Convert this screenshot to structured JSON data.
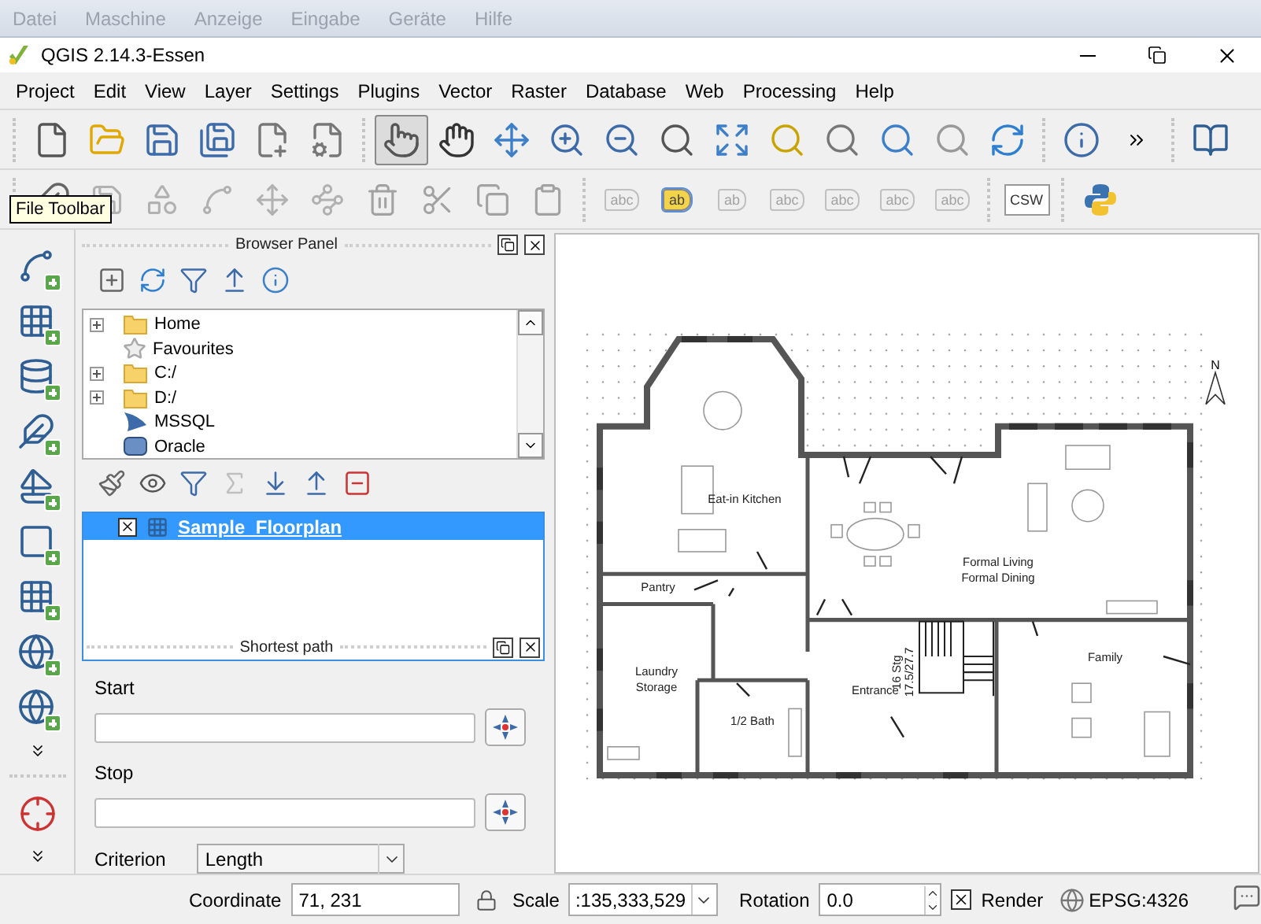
{
  "vm_menu": [
    {
      "label": "Datei",
      "disabled": true
    },
    {
      "label": "Maschine",
      "disabled": true
    },
    {
      "label": "Anzeige",
      "disabled": true
    },
    {
      "label": "Eingabe",
      "disabled": true
    },
    {
      "label": "Geräte",
      "disabled": true
    },
    {
      "label": "Hilfe",
      "disabled": true
    }
  ],
  "window": {
    "title": "QGIS 2.14.3-Essen"
  },
  "menu": [
    "Project",
    "Edit",
    "View",
    "Layer",
    "Settings",
    "Plugins",
    "Vector",
    "Raster",
    "Database",
    "Web",
    "Processing",
    "Help"
  ],
  "toolbar_1": {
    "groups": [
      {
        "buttons": [
          {
            "kind": "new",
            "selected": false
          },
          {
            "kind": "open",
            "selected": false
          },
          {
            "kind": "save",
            "selected": false
          },
          {
            "kind": "save_as",
            "selected": false
          },
          {
            "kind": "new_composer",
            "selected": false
          },
          {
            "kind": "composer_manager",
            "selected": false
          }
        ]
      },
      {
        "buttons": [
          {
            "kind": "touch_pan",
            "selected": true
          },
          {
            "kind": "pan",
            "selected": false
          },
          {
            "kind": "pan_selection",
            "selected": false
          },
          {
            "kind": "zoom_in",
            "selected": false
          },
          {
            "kind": "zoom_out",
            "selected": false
          },
          {
            "kind": "zoom_native",
            "selected": false
          },
          {
            "kind": "zoom_full",
            "selected": false
          },
          {
            "kind": "zoom_selection",
            "selected": false
          },
          {
            "kind": "zoom_layer",
            "selected": false
          },
          {
            "kind": "zoom_last",
            "selected": false
          },
          {
            "kind": "zoom_next",
            "selected": false
          },
          {
            "kind": "refresh",
            "selected": false
          }
        ]
      },
      {
        "buttons": [
          {
            "kind": "identify",
            "selected": false
          },
          {
            "kind": "more",
            "selected": false
          }
        ]
      },
      {
        "buttons": [
          {
            "kind": "help",
            "selected": false
          }
        ]
      }
    ]
  },
  "toolbar_2": {
    "groups": [
      {
        "buttons": [
          {
            "kind": "save_edits",
            "disabled": true
          },
          {
            "kind": "add_feature",
            "disabled": true
          },
          {
            "kind": "node_tool",
            "disabled": true
          },
          {
            "kind": "move_feature",
            "disabled": true
          },
          {
            "kind": "node_edit",
            "disabled": true
          },
          {
            "kind": "delete",
            "disabled": true
          },
          {
            "kind": "cut",
            "disabled": true
          },
          {
            "kind": "copy",
            "disabled": true
          },
          {
            "kind": "paste",
            "disabled": true
          }
        ]
      },
      {
        "buttons": [
          {
            "kind": "label",
            "caption": "abc",
            "disabled": true,
            "selected": false
          },
          {
            "kind": "label",
            "caption": "ab",
            "disabled": false,
            "selected": true
          },
          {
            "kind": "label",
            "caption": "ab",
            "disabled": true,
            "selected": false
          },
          {
            "kind": "label",
            "caption": "abc",
            "disabled": true,
            "selected": false
          },
          {
            "kind": "label",
            "caption": "abc",
            "disabled": true,
            "selected": false
          },
          {
            "kind": "label",
            "caption": "abc",
            "disabled": true,
            "selected": false
          },
          {
            "kind": "label",
            "caption": "abc",
            "disabled": true,
            "selected": false
          }
        ]
      },
      {
        "buttons": [
          {
            "kind": "csw",
            "caption": "CSW",
            "disabled": false
          }
        ]
      },
      {
        "buttons": [
          {
            "kind": "python",
            "disabled": false
          }
        ]
      }
    ]
  },
  "tooltip": "File Toolbar",
  "left_toolbar": [
    {
      "kind": "add_vector"
    },
    {
      "kind": "add_raster"
    },
    {
      "kind": "add_postgis"
    },
    {
      "kind": "add_spatialite"
    },
    {
      "kind": "add_mssql"
    },
    {
      "kind": "add_oracle"
    },
    {
      "kind": "add_db2"
    },
    {
      "kind": "add_wms"
    },
    {
      "kind": "add_wfs"
    },
    {
      "kind": "more_down"
    },
    {
      "kind": "separator"
    },
    {
      "kind": "crosshair"
    },
    {
      "kind": "more_down"
    }
  ],
  "browser_panel": {
    "title": "Browser Panel",
    "toolbar": [
      {
        "kind": "add_selected"
      },
      {
        "kind": "refresh"
      },
      {
        "kind": "filter"
      },
      {
        "kind": "collapse"
      },
      {
        "kind": "info"
      }
    ],
    "tree": [
      {
        "label": "Home",
        "kind": "folder",
        "expandable": true
      },
      {
        "label": "Favourites",
        "kind": "star",
        "expandable": false
      },
      {
        "label": "C:/",
        "kind": "folder",
        "expandable": true
      },
      {
        "label": "D:/",
        "kind": "folder",
        "expandable": true
      },
      {
        "label": "MSSQL",
        "kind": "mssql",
        "expandable": false
      },
      {
        "label": "Oracle",
        "kind": "oracle",
        "expandable": false
      }
    ]
  },
  "layers_panel": {
    "toolbar": [
      {
        "kind": "styling",
        "disabled": false
      },
      {
        "kind": "visibility",
        "disabled": false
      },
      {
        "kind": "filter",
        "disabled": false
      },
      {
        "kind": "expression",
        "disabled": true
      },
      {
        "kind": "expand",
        "disabled": false
      },
      {
        "kind": "collapse",
        "disabled": false
      },
      {
        "kind": "remove",
        "disabled": false
      }
    ],
    "layers": [
      {
        "name": "Sample_Floorplan",
        "visible": true,
        "selected": true
      }
    ]
  },
  "shortest_path_panel": {
    "title": "Shortest path",
    "start_label": "Start",
    "stop_label": "Stop",
    "criterion_label": "Criterion",
    "criterion": "Length"
  },
  "map": {
    "labels": [
      "Eat-in Kitchen",
      "Pantry",
      "Formal Living",
      "Formal Dining",
      "Laundry",
      "Storage",
      "1/2 Bath",
      "Entrance",
      "Family",
      "16 Stg",
      "17.5/27.7"
    ],
    "north": "N"
  },
  "status_bar": {
    "coordinate_label": "Coordinate",
    "coordinate": "71, 231",
    "scale_label": "Scale",
    "scale": ":135,333,529",
    "rotation_label": "Rotation",
    "rotation": "0.0",
    "render_label": "Render",
    "render": true,
    "crs": "EPSG:4326"
  }
}
